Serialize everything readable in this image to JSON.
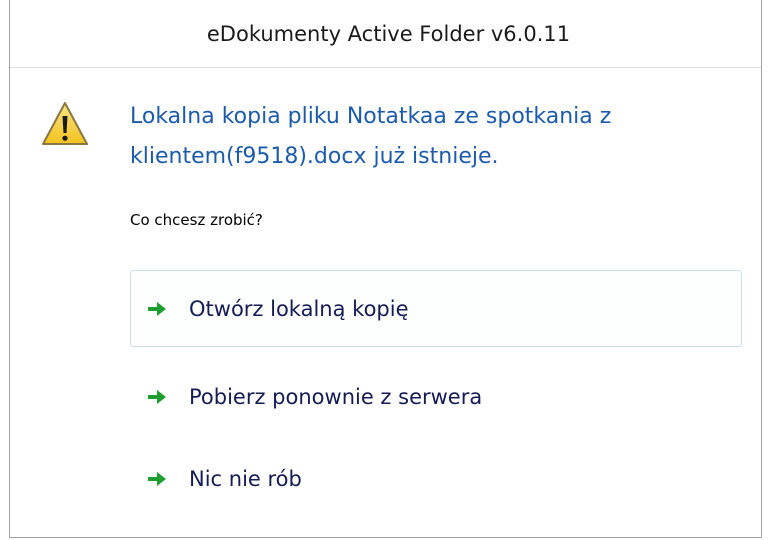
{
  "dialog": {
    "title": "eDokumenty Active Folder v6.0.11",
    "icon": "warning-icon",
    "main_instruction": "Lokalna kopia pliku Notatkaa ze spotkania z klientem(f9518).docx już istnieje.",
    "question": "Co chcesz zrobić?",
    "commands": [
      {
        "label": "Otwórz lokalną kopię",
        "icon": "green-arrow-icon",
        "focused": true
      },
      {
        "label": "Pobierz ponownie z serwera",
        "icon": "green-arrow-icon",
        "focused": false
      },
      {
        "label": "Nic nie rób",
        "icon": "green-arrow-icon",
        "focused": false
      }
    ]
  },
  "colors": {
    "instruction_text": "#1c5bab",
    "command_text": "#151c55",
    "arrow_green": "#1e9e2e",
    "warning_yellow": "#f7d13a",
    "focus_border": "#c9e2f2"
  }
}
